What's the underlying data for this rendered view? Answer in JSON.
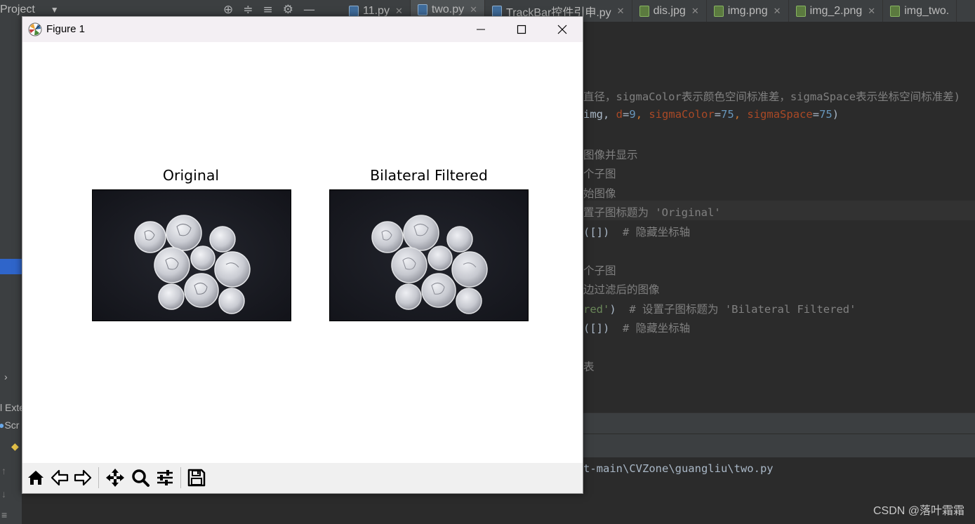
{
  "ide": {
    "project_label": "Project",
    "tabs": [
      {
        "label": "11.py",
        "kind": "py",
        "active": false
      },
      {
        "label": "two.py",
        "kind": "py",
        "active": true
      },
      {
        "label": "TrackBar控件引申.py",
        "kind": "py",
        "active": false
      },
      {
        "label": "dis.jpg",
        "kind": "img",
        "active": false
      },
      {
        "label": "img.png",
        "kind": "img",
        "active": false
      },
      {
        "label": "img_2.png",
        "kind": "img",
        "active": false
      },
      {
        "label": "img_two.",
        "kind": "img",
        "active": false
      }
    ],
    "left_panel": {
      "item_1": "l Exte",
      "item_2": "Scr"
    },
    "code_lines": {
      "l1": "直径，sigmaColor表示颜色空间标准差，sigmaSpace表示坐标空间标准差)",
      "l2_a": "img, ",
      "l2_b": "d",
      "l2_c": "=",
      "l2_d": "9",
      "l2_e": ", ",
      "l2_f": "sigmaColor",
      "l2_g": "=",
      "l2_h": "75",
      "l2_i": ", ",
      "l2_j": "sigmaSpace",
      "l2_k": "=",
      "l2_l": "75",
      "l2_m": ")",
      "l3": "图像并显示",
      "l4": "个子图",
      "l5": "始图像",
      "l6_a": "置子图标题为 ",
      "l6_b": "'Original'",
      "l7_a": "([])  ",
      "l7_b": "# 隐藏坐标轴",
      "l8": "个子图",
      "l9": "边过滤后的图像",
      "l10_a": "red'",
      "l10_b": ")  ",
      "l10_c": "# 设置子图标题为 ",
      "l10_d": "'Bilateral Filtered'",
      "l11_a": "([])  ",
      "l11_b": "# 隐藏坐标轴",
      "l12": "表"
    },
    "console_line": "t-main\\CVZone\\guangliu\\two.py",
    "watermark": "CSDN @落叶霜霜"
  },
  "figure": {
    "window_title": "Figure 1",
    "subplots": [
      {
        "title": "Original"
      },
      {
        "title": "Bilateral Filtered"
      }
    ],
    "toolbar": {
      "home": "home-icon",
      "back": "back-arrow-icon",
      "forward": "forward-arrow-icon",
      "pan": "pan-icon",
      "zoom": "zoom-icon",
      "configure": "configure-subplots-icon",
      "save": "save-icon"
    }
  }
}
